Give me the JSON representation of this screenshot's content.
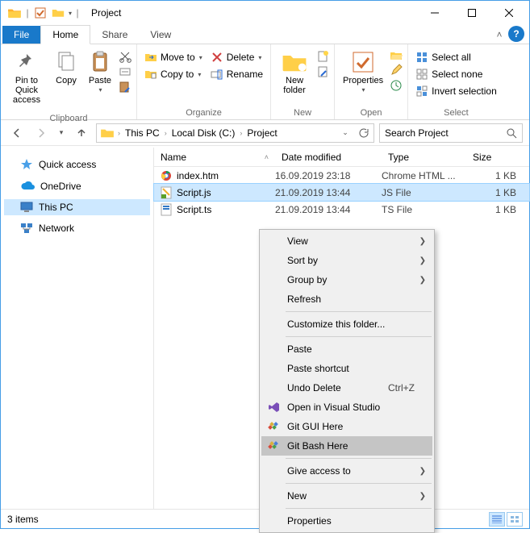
{
  "window": {
    "title": "Project"
  },
  "tabs": {
    "file": "File",
    "home": "Home",
    "share": "Share",
    "view": "View"
  },
  "ribbon": {
    "clipboard": {
      "label": "Clipboard",
      "pin": "Pin to Quick\naccess",
      "copy": "Copy",
      "paste": "Paste"
    },
    "organize": {
      "label": "Organize",
      "move": "Move to",
      "copy": "Copy to",
      "delete": "Delete",
      "rename": "Rename"
    },
    "new": {
      "label": "New",
      "folder": "New\nfolder"
    },
    "open": {
      "label": "Open",
      "props": "Properties"
    },
    "select": {
      "label": "Select",
      "all": "Select all",
      "none": "Select none",
      "invert": "Invert selection"
    }
  },
  "breadcrumb": [
    "This PC",
    "Local Disk (C:)",
    "Project"
  ],
  "search": {
    "placeholder": "Search Project"
  },
  "nav": {
    "quick": "Quick access",
    "onedrive": "OneDrive",
    "thispc": "This PC",
    "network": "Network"
  },
  "columns": {
    "name": "Name",
    "date": "Date modified",
    "type": "Type",
    "size": "Size"
  },
  "files": [
    {
      "name": "index.htm",
      "date": "16.09.2019 23:18",
      "type": "Chrome HTML ...",
      "size": "1 KB",
      "icon": "chrome"
    },
    {
      "name": "Script.js",
      "date": "21.09.2019 13:44",
      "type": "JS File",
      "size": "1 KB",
      "icon": "js"
    },
    {
      "name": "Script.ts",
      "date": "21.09.2019 13:44",
      "type": "TS File",
      "size": "1 KB",
      "icon": "ts"
    }
  ],
  "status": {
    "count": "3 items"
  },
  "context_menu": [
    {
      "label": "View",
      "sub": true
    },
    {
      "label": "Sort by",
      "sub": true
    },
    {
      "label": "Group by",
      "sub": true
    },
    {
      "label": "Refresh"
    },
    {
      "sep": true
    },
    {
      "label": "Customize this folder..."
    },
    {
      "sep": true
    },
    {
      "label": "Paste",
      "disabled": true
    },
    {
      "label": "Paste shortcut",
      "disabled": true
    },
    {
      "label": "Undo Delete",
      "shortcut": "Ctrl+Z"
    },
    {
      "label": "Open in Visual Studio",
      "icon": "vs"
    },
    {
      "label": "Git GUI Here",
      "icon": "git"
    },
    {
      "label": "Git Bash Here",
      "icon": "git",
      "hov": true
    },
    {
      "sep": true
    },
    {
      "label": "Give access to",
      "sub": true
    },
    {
      "sep": true
    },
    {
      "label": "New",
      "sub": true
    },
    {
      "sep": true
    },
    {
      "label": "Properties"
    }
  ]
}
